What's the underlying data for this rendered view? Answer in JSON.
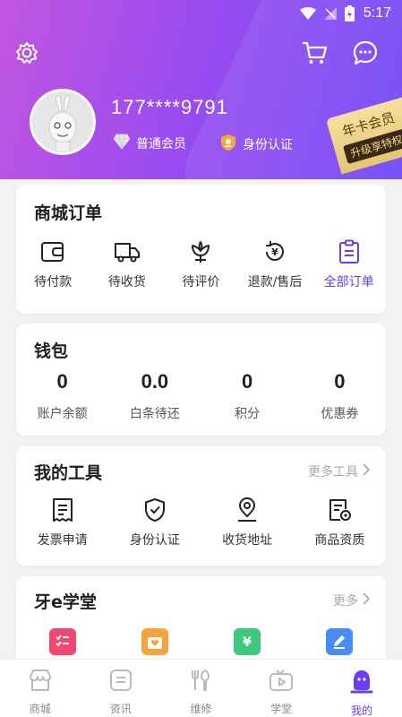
{
  "statusbar": {
    "time": "5:17"
  },
  "profile": {
    "phone": "177****9791",
    "member_level": "普通会员",
    "identity": "身份认证",
    "vip_line1": "年卡会员",
    "vip_line2": "升级享特权"
  },
  "orders": {
    "title": "商城订单",
    "items": [
      {
        "label": "待付款",
        "icon": "wallet-icon"
      },
      {
        "label": "待收货",
        "icon": "truck-icon"
      },
      {
        "label": "待评价",
        "icon": "flower-icon"
      },
      {
        "label": "退款/售后",
        "icon": "refund-icon"
      },
      {
        "label": "全部订单",
        "icon": "clipboard-icon"
      }
    ]
  },
  "wallet": {
    "title": "钱包",
    "items": [
      {
        "value": "0",
        "label": "账户余额"
      },
      {
        "value": "0.0",
        "label": "白条待还"
      },
      {
        "value": "0",
        "label": "积分"
      },
      {
        "value": "0",
        "label": "优惠券"
      }
    ]
  },
  "tools": {
    "title": "我的工具",
    "more": "更多工具",
    "items": [
      {
        "label": "发票申请",
        "icon": "receipt-icon"
      },
      {
        "label": "身份认证",
        "icon": "shield-check-icon"
      },
      {
        "label": "收货地址",
        "icon": "location-pin-icon"
      },
      {
        "label": "商品资质",
        "icon": "certificate-icon"
      }
    ]
  },
  "school": {
    "title": "牙e学堂",
    "more": "更多",
    "icons": [
      {
        "icon": "checklist-icon",
        "color": "#f2456f"
      },
      {
        "icon": "heart-box-icon",
        "color": "#f7a33b"
      },
      {
        "icon": "yen-ticket-icon",
        "color": "#3cc97f"
      },
      {
        "icon": "edit-note-icon",
        "color": "#4a8cf5"
      }
    ]
  },
  "tabbar": {
    "items": [
      {
        "label": "商城",
        "icon": "store-icon"
      },
      {
        "label": "资讯",
        "icon": "news-icon"
      },
      {
        "label": "维修",
        "icon": "repair-tools-icon"
      },
      {
        "label": "学堂",
        "icon": "tv-play-icon"
      },
      {
        "label": "我的",
        "icon": "user-mascot-icon"
      }
    ],
    "active_color": "#6c3cf0"
  },
  "colors": {
    "accent": "#6c3cf0",
    "header_start": "#c255e0",
    "header_end": "#6d44f5"
  }
}
